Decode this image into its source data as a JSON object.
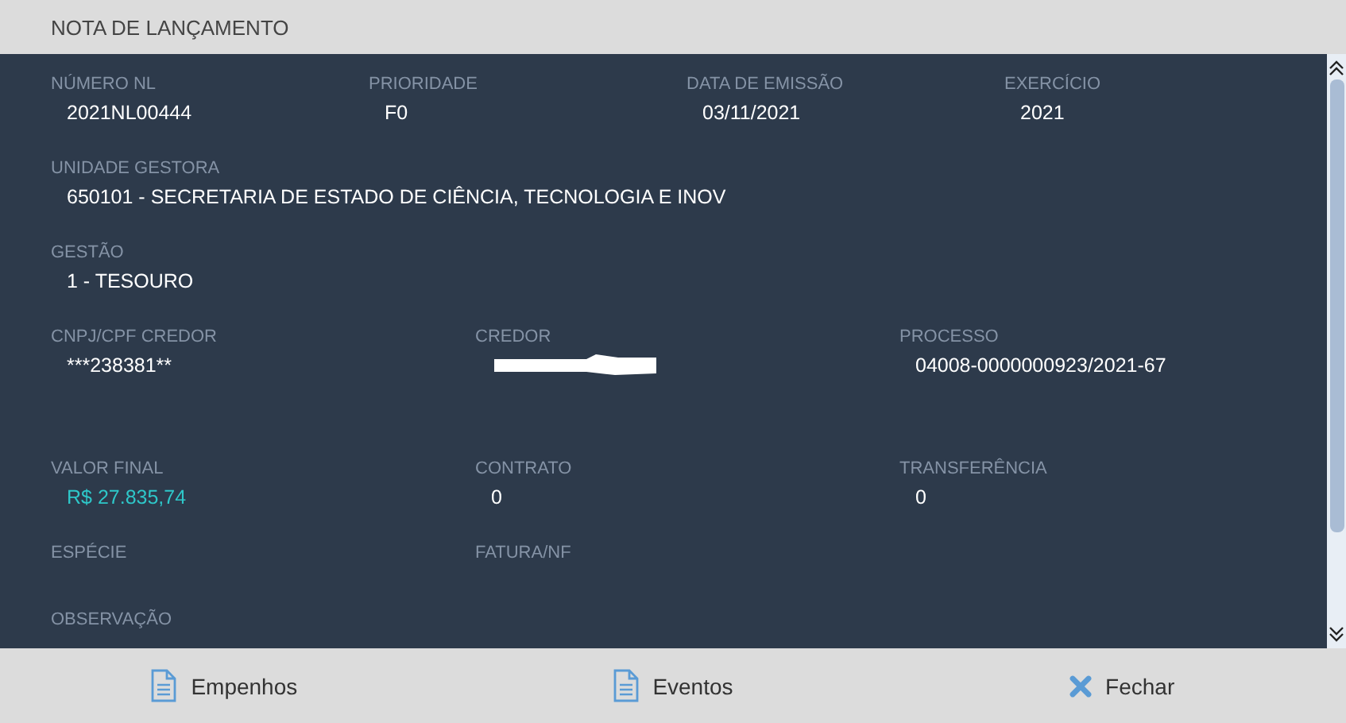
{
  "window": {
    "title": "NOTA DE LANÇAMENTO"
  },
  "rows": [
    {
      "fields": [
        {
          "label": "NÚMERO NL",
          "value": "2021NL00444",
          "kind": "text"
        },
        {
          "label": "PRIORIDADE",
          "value": "F0",
          "kind": "text"
        },
        {
          "label": "DATA DE EMISSÃO",
          "value": "03/11/2021",
          "kind": "text"
        },
        {
          "label": "EXERCÍCIO",
          "value": "2021",
          "kind": "text"
        }
      ]
    },
    {
      "fields": [
        {
          "label": "UNIDADE GESTORA",
          "value": "650101 - SECRETARIA DE ESTADO DE CIÊNCIA, TECNOLOGIA E INOV",
          "kind": "text"
        }
      ]
    },
    {
      "fields": [
        {
          "label": "GESTÃO",
          "value": "1 - TESOURO",
          "kind": "text"
        }
      ]
    },
    {
      "fields": [
        {
          "label": "CNPJ/CPF CREDOR",
          "value": "***238381**",
          "kind": "text"
        },
        {
          "label": "CREDOR",
          "kind": "redacted"
        },
        {
          "label": "PROCESSO",
          "value": "04008-0000000923/2021-67",
          "kind": "text"
        }
      ]
    },
    {
      "fields": [
        {
          "label": "VALOR FINAL",
          "value": "R$ 27.835,74",
          "kind": "money"
        },
        {
          "label": "CONTRATO",
          "value": "0",
          "kind": "text"
        },
        {
          "label": "TRANSFERÊNCIA",
          "value": "0",
          "kind": "text"
        }
      ]
    },
    {
      "fields": [
        {
          "label": "ESPÉCIE",
          "kind": "text"
        },
        {
          "label": "FATURA/NF",
          "kind": "text"
        }
      ]
    },
    {
      "fields": [
        {
          "label": "OBSERVAÇÃO",
          "kind": "text"
        }
      ]
    }
  ],
  "buttons": [
    {
      "label": "Empenhos",
      "kind": "document"
    },
    {
      "label": "Eventos",
      "kind": "document"
    },
    {
      "label": "Fechar",
      "kind": "close"
    }
  ]
}
